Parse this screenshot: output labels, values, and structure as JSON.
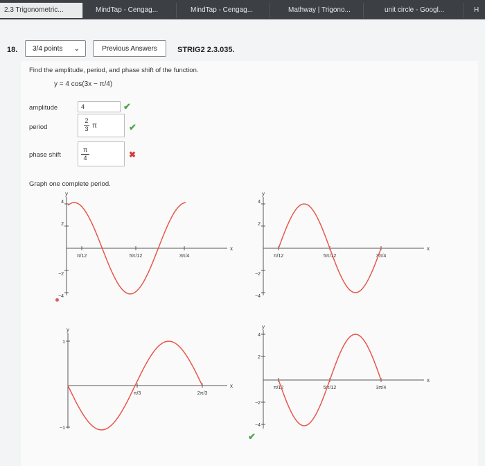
{
  "browser_tabs": [
    {
      "label": "2.3 Trigonometric...",
      "active": true
    },
    {
      "label": "MindTap - Cengag...",
      "active": false
    },
    {
      "label": "MindTap - Cengag...",
      "active": false
    },
    {
      "label": "Mathway | Trigono...",
      "active": false
    },
    {
      "label": "unit circle - Googl...",
      "active": false
    },
    {
      "label": "H",
      "active": false
    }
  ],
  "question": {
    "number": "18.",
    "points_select": "3/4 points",
    "previous_answers_label": "Previous Answers",
    "code": "STRIG2 2.3.035.",
    "instruction": "Find the amplitude, period, and phase shift of the function.",
    "equation": "y = 4 cos(3x − π/4)",
    "amplitude_label": "amplitude",
    "amplitude_value": "4",
    "amplitude_status": "correct",
    "period_label": "period",
    "period_value_num": "2",
    "period_value_den": "3",
    "period_suffix": "π",
    "period_status": "correct",
    "phase_shift_label": "phase shift",
    "phase_value_num": "π",
    "phase_value_den": "4",
    "phase_status": "incorrect",
    "graph_prompt": "Graph one complete period."
  },
  "graphs": [
    {
      "id": "a",
      "y_label": "y",
      "x_label": "x",
      "y_ticks": [
        "4",
        "2",
        "−2",
        "−4"
      ],
      "x_ticks": [
        "π/12",
        "5π/12",
        "3π/4"
      ]
    },
    {
      "id": "b",
      "y_label": "y",
      "x_label": "x",
      "y_ticks": [
        "4",
        "2",
        "−2",
        "−4"
      ],
      "x_ticks": [
        "π/12",
        "5π/12",
        "3π/4"
      ]
    },
    {
      "id": "c",
      "y_label": "y",
      "x_label": "x",
      "y_ticks": [
        "1",
        "−1"
      ],
      "x_ticks": [
        "π/3",
        "2π/3"
      ]
    },
    {
      "id": "d",
      "y_label": "y",
      "x_label": "x",
      "y_ticks": [
        "4",
        "2",
        "−2",
        "−4"
      ],
      "x_ticks": [
        "π/12",
        "5π/12",
        "3π/4"
      ]
    }
  ],
  "colors": {
    "curve": "#e8574a",
    "correct": "#4ca64c",
    "incorrect": "#d23b3b",
    "tab_bar": "#3c3f44"
  }
}
